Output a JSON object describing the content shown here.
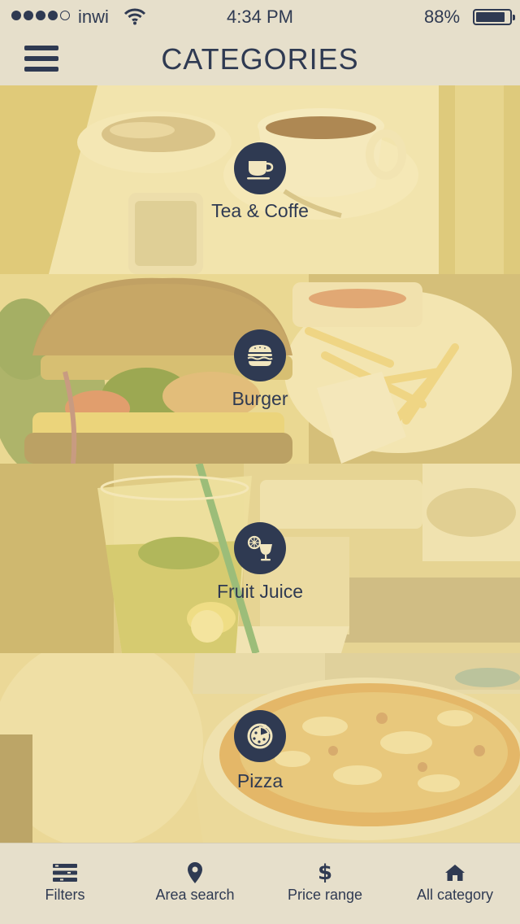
{
  "status_bar": {
    "carrier": "inwi",
    "time": "4:34 PM",
    "battery_percent": "88%",
    "battery_level": 0.88,
    "signal_bars_filled": 4,
    "signal_bars_total": 5
  },
  "header": {
    "title": "CATEGORIES",
    "menu_icon": "hamburger-menu-icon"
  },
  "categories": [
    {
      "label": "Tea & Coffe",
      "icon": "coffee-cup-icon"
    },
    {
      "label": "Burger",
      "icon": "burger-icon"
    },
    {
      "label": "Fruit Juice",
      "icon": "fruit-juice-icon"
    },
    {
      "label": "Pizza",
      "icon": "pizza-icon"
    }
  ],
  "tab_bar": {
    "tabs": [
      {
        "label": "Filters",
        "icon": "filters-icon"
      },
      {
        "label": "Area search",
        "icon": "map-pin-icon"
      },
      {
        "label": "Price range",
        "icon": "dollar-icon"
      },
      {
        "label": "All category",
        "icon": "home-icon"
      }
    ]
  },
  "colors": {
    "background": "#e6dfcb",
    "accent": "#2f3a52",
    "overlay": "#f0d678"
  }
}
